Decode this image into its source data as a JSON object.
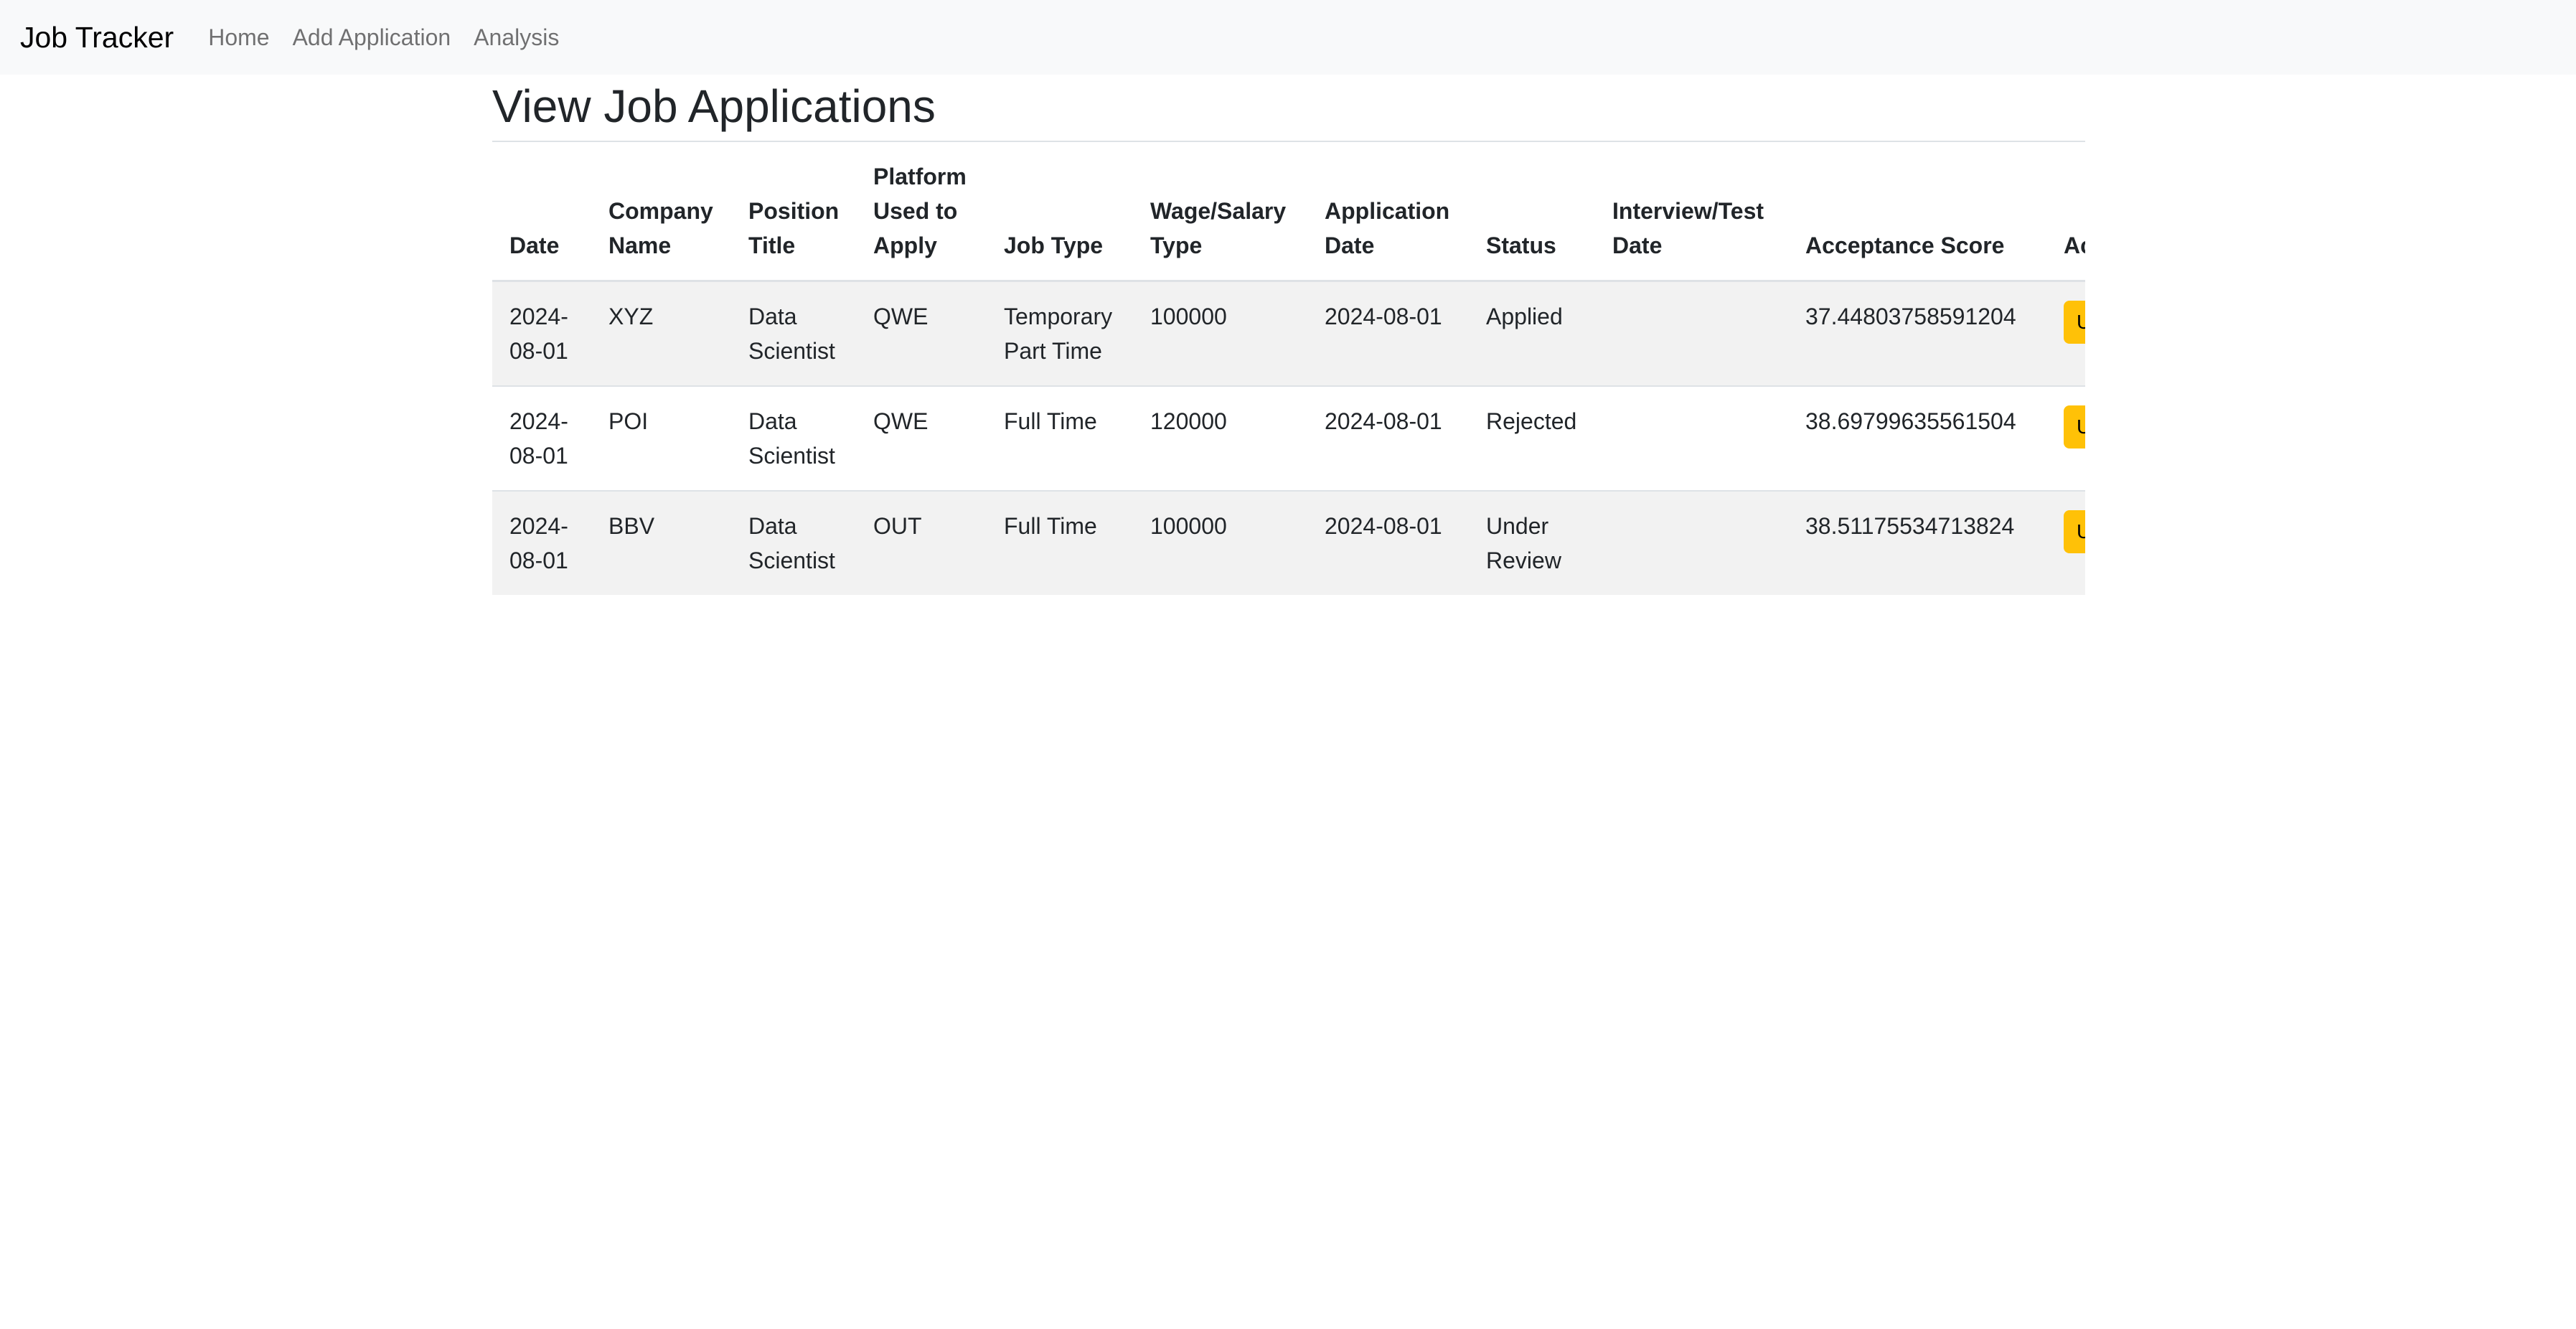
{
  "navbar": {
    "brand": "Job Tracker",
    "links": [
      "Home",
      "Add Application",
      "Analysis"
    ]
  },
  "page_title": "View Job Applications",
  "table": {
    "headers": [
      "Date",
      "Company Name",
      "Position Title",
      "Platform Used to Apply",
      "Job Type",
      "Wage/Salary Type",
      "Application Date",
      "Status",
      "Interview/Test Date",
      "Acceptance Score",
      "Actions"
    ],
    "rows": [
      {
        "cells": [
          "2024-08-01",
          "XYZ",
          "Data Scientist",
          "QWE",
          "Temporary Part Time",
          "100000",
          "2024-08-01",
          "Applied",
          "",
          "37.44803758591204"
        ],
        "action": "Update"
      },
      {
        "cells": [
          "2024-08-01",
          "POI",
          "Data Scientist",
          "QWE",
          "Full Time",
          "120000",
          "2024-08-01",
          "Rejected",
          "",
          "38.69799635561504"
        ],
        "action": "Update"
      },
      {
        "cells": [
          "2024-08-01",
          "BBV",
          "Data Scientist",
          "OUT",
          "Full Time",
          "100000",
          "2024-08-01",
          "Under Review",
          "",
          "38.51175534713824"
        ],
        "action": "Update"
      }
    ]
  },
  "colors": {
    "navbar_bg": "#f8f9fa",
    "row_stripe": "#f2f2f2",
    "update_button": "#ffc107"
  }
}
